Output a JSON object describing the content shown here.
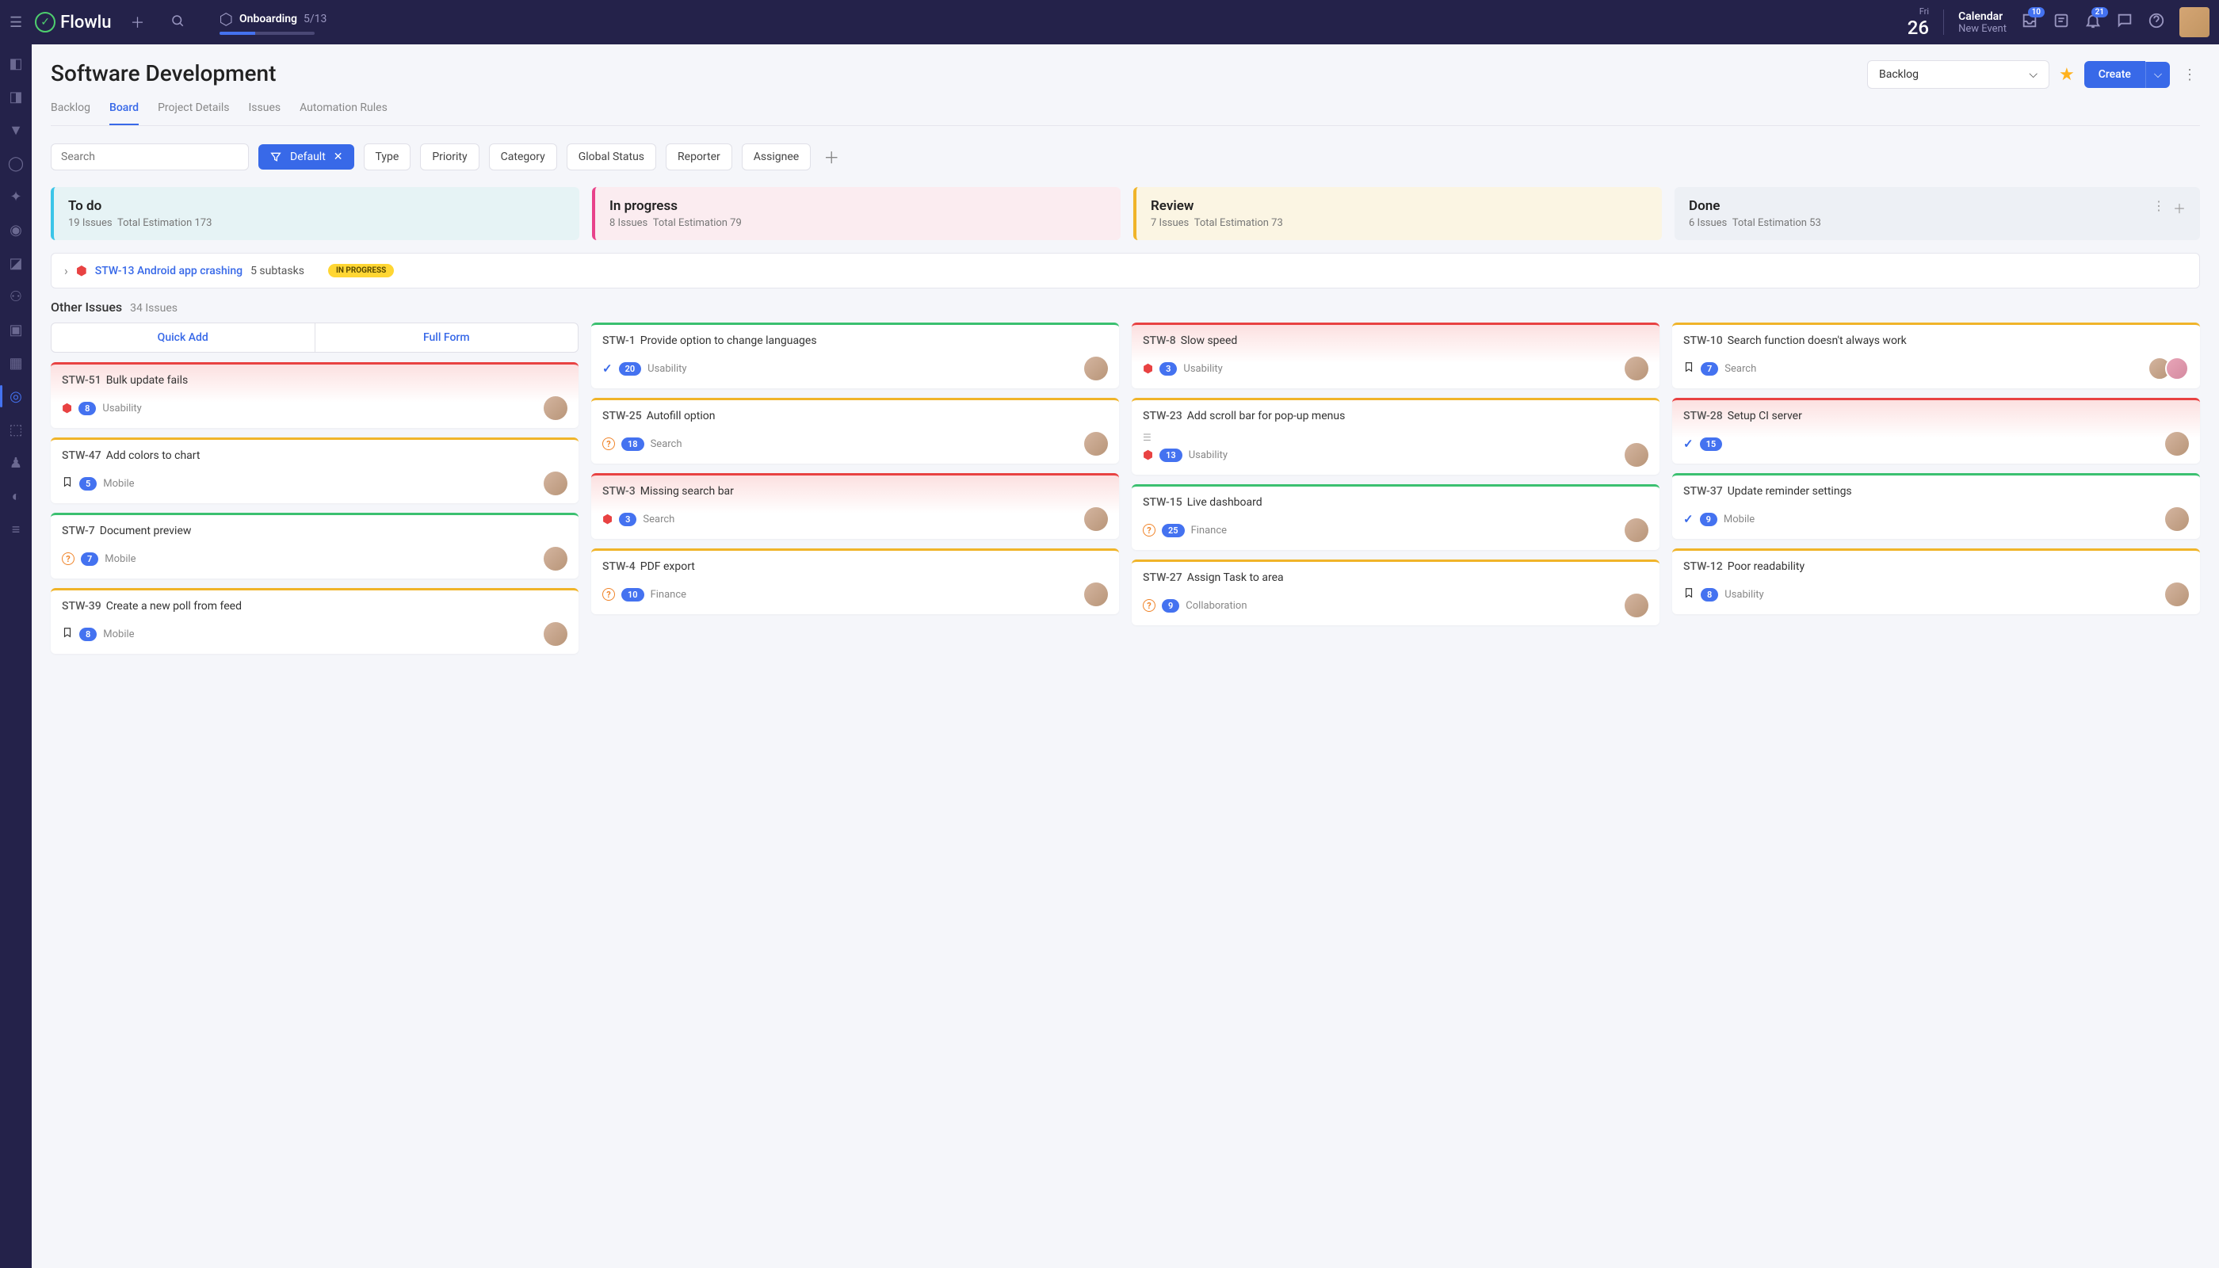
{
  "app": {
    "name": "Flowlu"
  },
  "onboarding": {
    "title": "Onboarding",
    "progress": "5/13"
  },
  "topbar": {
    "date_day": "Fri",
    "date_num": "26",
    "calendar_title": "Calendar",
    "calendar_sub": "New Event",
    "inbox_badge": "10",
    "bell_badge": "21"
  },
  "page": {
    "title": "Software Development"
  },
  "view_select": {
    "value": "Backlog"
  },
  "create_btn": "Create",
  "tabs": [
    "Backlog",
    "Board",
    "Project Details",
    "Issues",
    "Automation Rules"
  ],
  "search_placeholder": "Search",
  "filter_default": "Default",
  "filter_chips": [
    "Type",
    "Priority",
    "Category",
    "Global Status",
    "Reporter",
    "Assignee"
  ],
  "columns": [
    {
      "title": "To do",
      "issues": "19 Issues",
      "est": "Total Estimation 173"
    },
    {
      "title": "In progress",
      "issues": "8 Issues",
      "est": "Total Estimation 79"
    },
    {
      "title": "Review",
      "issues": "7 Issues",
      "est": "Total Estimation 73"
    },
    {
      "title": "Done",
      "issues": "6 Issues",
      "est": "Total Estimation 53"
    }
  ],
  "subtask_row": {
    "id": "STW-13",
    "title": "Android app crashing",
    "subtasks": "5 subtasks",
    "status": "IN PROGRESS"
  },
  "other": {
    "title": "Other Issues",
    "count": "34 Issues"
  },
  "quick": {
    "add": "Quick Add",
    "form": "Full Form"
  },
  "cards": {
    "todo": [
      {
        "id": "STW-51",
        "title": "Bulk update fails",
        "color": "red",
        "type": "bug",
        "count": "8",
        "tag": "Usability"
      },
      {
        "id": "STW-47",
        "title": "Add colors to chart",
        "color": "yellow",
        "type": "bookmark",
        "count": "5",
        "tag": "Mobile"
      },
      {
        "id": "STW-7",
        "title": "Document preview",
        "color": "green",
        "type": "question",
        "count": "7",
        "tag": "Mobile"
      },
      {
        "id": "STW-39",
        "title": "Create a new poll from feed",
        "color": "yellow",
        "type": "bookmark",
        "count": "8",
        "tag": "Mobile"
      }
    ],
    "progress": [
      {
        "id": "STW-1",
        "title": "Provide option to change languages",
        "color": "green",
        "type": "check",
        "count": "20",
        "tag": "Usability"
      },
      {
        "id": "STW-25",
        "title": "Autofill option",
        "color": "yellow",
        "type": "question",
        "count": "18",
        "tag": "Search"
      },
      {
        "id": "STW-3",
        "title": "Missing search bar",
        "color": "red",
        "type": "bug",
        "count": "3",
        "tag": "Search"
      },
      {
        "id": "STW-4",
        "title": "PDF export",
        "color": "yellow",
        "type": "question",
        "count": "10",
        "tag": "Finance"
      }
    ],
    "review": [
      {
        "id": "STW-8",
        "title": "Slow speed",
        "color": "red",
        "type": "bug",
        "count": "3",
        "tag": "Usability"
      },
      {
        "id": "STW-23",
        "title": "Add scroll bar for pop-up menus",
        "color": "yellow",
        "type": "bug",
        "count": "13",
        "tag": "Usability",
        "list": true
      },
      {
        "id": "STW-15",
        "title": "Live dashboard",
        "color": "green",
        "type": "question",
        "count": "25",
        "tag": "Finance"
      },
      {
        "id": "STW-27",
        "title": "Assign Task to area",
        "color": "yellow",
        "type": "question",
        "count": "9",
        "tag": "Collaboration"
      }
    ],
    "done": [
      {
        "id": "STW-10",
        "title": "Search function doesn't always work",
        "color": "yellow",
        "type": "bookmark",
        "count": "7",
        "tag": "Search",
        "multi": true
      },
      {
        "id": "STW-28",
        "title": "Setup CI server",
        "color": "red",
        "type": "check",
        "count": "15",
        "tag": ""
      },
      {
        "id": "STW-37",
        "title": "Update reminder settings",
        "color": "green",
        "type": "check",
        "count": "9",
        "tag": "Mobile"
      },
      {
        "id": "STW-12",
        "title": "Poor readability",
        "color": "yellow",
        "type": "bookmark",
        "count": "8",
        "tag": "Usability"
      }
    ]
  }
}
